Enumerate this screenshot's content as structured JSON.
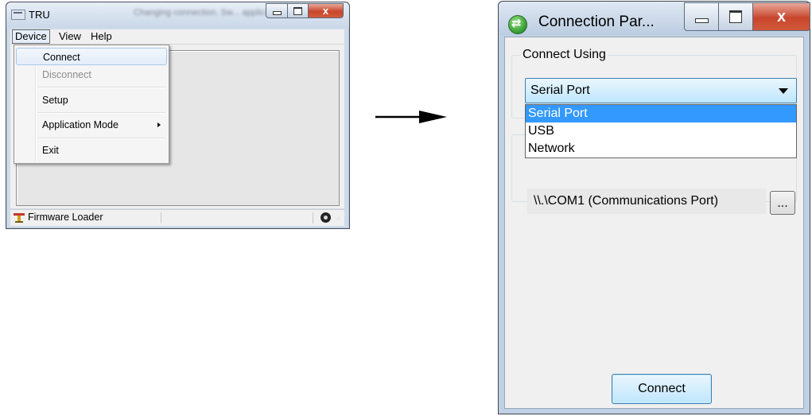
{
  "tru_window": {
    "title": "TRU",
    "blurred_title_text": "Changing connection. Sw... application mode",
    "menu": [
      "Device",
      "View",
      "Help"
    ],
    "device_menu": {
      "items": [
        {
          "label": "Connect",
          "state": "highlighted"
        },
        {
          "label": "Disconnect",
          "state": "disabled"
        },
        {
          "label": "Setup",
          "state": "normal"
        },
        {
          "label": "Application Mode",
          "state": "submenu"
        },
        {
          "label": "Exit",
          "state": "normal"
        }
      ]
    },
    "status_bar": {
      "label": "Firmware Loader",
      "icon": "firmware-icon",
      "disk_icon": "disk-icon"
    },
    "controls": {
      "close": "x"
    }
  },
  "arrow": {
    "icon": "right-arrow"
  },
  "connection_window": {
    "title": "Connection Par...",
    "controls": {
      "close": "x"
    },
    "connect_using_label": "Connect Using",
    "combo_value": "Serial Port",
    "options": [
      "Serial Port",
      "USB",
      "Network"
    ],
    "selected_option": "Serial Port",
    "port_value": "\\\\.\\COM1 (Communications Port)",
    "browse_label": "...",
    "connect_button": "Connect"
  },
  "colors": {
    "selection": "#3399ff",
    "close_button": "#c8462c",
    "accent_border": "#3c7fb1"
  }
}
